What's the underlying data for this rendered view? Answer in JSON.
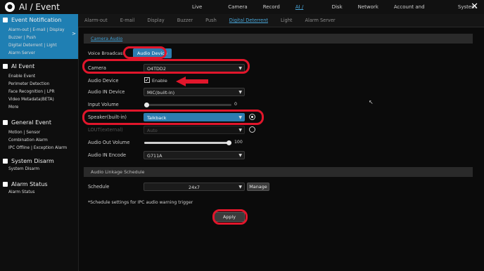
{
  "window": {
    "title": "AI / Event",
    "top_nav": [
      "Live View",
      "Camera",
      "Record",
      "AI / Event",
      "Disk",
      "Network",
      "Account and Authority",
      "System"
    ],
    "top_nav_active": "AI / Event",
    "close_icon": "close-icon"
  },
  "subnav": {
    "items": [
      "Alarm-out",
      "E-mail",
      "Display",
      "Buzzer",
      "Push",
      "Digital Deterrent",
      "Light",
      "Alarm Server"
    ],
    "active": "Digital Deterrent"
  },
  "sidebar": {
    "sections": [
      {
        "title": "Event Notification",
        "icon": "bell-icon",
        "active": true,
        "items": [
          "Alarm-out | E-mail | Display",
          "Buzzer | Push",
          "Digital Deterrent | Light",
          "Alarm Server"
        ]
      },
      {
        "title": "AI Event",
        "icon": "ai-icon",
        "active": false,
        "items": [
          "Enable Event",
          "Perimeter Detection",
          "Face Recognition | LPR",
          "Video Metadata(BETA)",
          "More"
        ]
      },
      {
        "title": "General Event",
        "icon": "gear-icon",
        "active": false,
        "items": [
          "Motion | Sensor",
          "Combination Alarm",
          "IPC Offline | Exception Alarm"
        ]
      },
      {
        "title": "System Disarm",
        "icon": "shield-icon",
        "active": false,
        "items": [
          "System Disarm"
        ]
      },
      {
        "title": "Alarm Status",
        "icon": "alarm-icon",
        "active": false,
        "items": [
          "Alarm Status"
        ]
      }
    ],
    "expand_arrow": ">"
  },
  "main": {
    "section_camera_audio": "Camera Audio",
    "tabs": [
      "Voice Broadcast",
      "Audio Device"
    ],
    "tabs_active": "Audio Device",
    "fields": {
      "camera_label": "Camera",
      "camera_value": "O4TDD2",
      "audio_device_label": "Audio Device",
      "audio_device_enable_label": "Enable",
      "audio_device_enabled": true,
      "audio_in_device_label": "Audio IN Device",
      "audio_in_device_value": "MIC(built-in)",
      "input_volume_label": "Input Volume",
      "input_volume_value": "0",
      "speaker_label": "Speaker(built-in)",
      "speaker_value": "Talkback",
      "lou_label": "LOUT(external)",
      "lou_value": "Auto",
      "audio_out_volume_label": "Audio Out Volume",
      "audio_out_volume_value": "100",
      "audio_in_encode_label": "Audio IN Encode",
      "audio_in_encode_value": "G711A"
    },
    "section_linkage": "Audio Linkage Schedule",
    "schedule_label": "Schedule",
    "schedule_value": "24x7",
    "manage_button": "Manage",
    "note": "*Schedule settings for IPC audio warning trigger",
    "apply_button": "Apply"
  },
  "colors": {
    "accent": "#2d7db0",
    "highlight": "#e1162b",
    "background": "#0b0b0b"
  }
}
